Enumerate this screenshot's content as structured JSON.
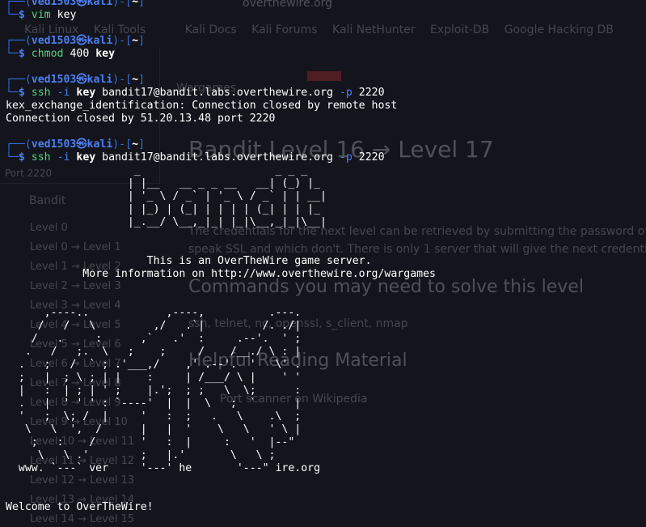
{
  "background": {
    "url_domain": "overthewire.org",
    "bookmarks": [
      "Kali Linux",
      "Kali Tools",
      "Kali Docs",
      "Kali Forums",
      "Kali NetHunter",
      "Exploit-DB",
      "Google Hacking DB"
    ],
    "wargames_label": "Wargames",
    "port_label": "Port 2220",
    "sidebar_title": "Bandit",
    "page_title": "Bandit Level 16 → Level 17",
    "text_1": "The credentials for the next level can be retrieved by submitting the password of the c",
    "text_2": "speak SSL and which don't. There is only 1 server that will give the next credentials, th",
    "commands_heading": "Commands you may need to solve this level",
    "commands_list": "ssh, telnet, nc, openssl, s_client, nmap",
    "reading_heading": "Helpful Reading Material",
    "reading_link": "Port scanner on Wikipedia",
    "levels": [
      "Level 0",
      "Level 0 → Level 1",
      "Level 1 → Level 2",
      "Level 2 → Level 3",
      "Level 3 → Level 4",
      "Level 4 → Level 5",
      "Level 5 → Level 6",
      "Level 6 → Level 7",
      "Level 7 → Level 8",
      "Level 8 → Level 9",
      "Level 9 → Level 10",
      "Level 10 → Level 11",
      "Level 11 → Level 12",
      "Level 12 → Level 13",
      "Level 13 → Level 14",
      "Level 14 → Level 15"
    ]
  },
  "prompt": {
    "user": "ved1503",
    "at_symbol": "㉿",
    "host": "kali",
    "dir": "~",
    "top_left": "┌──(",
    "close_paren": ")-[",
    "close_bracket": "]",
    "bottom_left": "└─",
    "dollar": "$"
  },
  "commands": [
    {
      "cmd": "vim",
      "args": " key",
      "bold_key": ""
    },
    {
      "cmd": "chmod",
      "args": " 400 ",
      "bold_key": "key"
    },
    {
      "cmd": "ssh",
      "opt1": " -i ",
      "bold_key": "key",
      "host": " bandit17@bandit.labs.overthewire.org ",
      "opt2": "-p",
      "port": " 2220"
    },
    {
      "cmd": "ssh",
      "opt1": " -i ",
      "bold_key": "key",
      "host": " bandit17@bandit.labs.overthewire.org ",
      "opt2": "-p",
      "port": " 2220"
    }
  ],
  "output": {
    "kex_error": "kex_exchange_identification: Connection closed by remote host",
    "closed": "Connection closed by 51.20.13.48 port 2220"
  },
  "banner_art": [
    "                    _                     _ _ _",
    "                   | |__   __ _ _ __   __| (_) |_",
    "                   | '_ \\ / _` | '_ \\ / _` | | __|",
    "                   | |_) | (_| | | | | (_| | | |_",
    "                   |_.__/ \\__,_|_| |_|\\__,_|_|\\__|"
  ],
  "server_msg_1": "                      This is an OverTheWire game server.",
  "server_msg_2": "            More information on http://www.overthewire.org/wargames",
  "otw_art": [
    "      ,----..            ,----,          .---.",
    "     /   /   \\         ,/   .`|         /. ./|",
    "    /   .     :      ,`   .'  :     .--'.  ' ;",
    "   .   /   ;.  \\   ;    ;     /    /__./ \\ : |",
    "  .   ;   /  ` ; .'___,/    ,' .--'.  '   \\' .",
    "  ;   |  ; \\ ; | |    :     | /___/ \\ |    ' '",
    "  |   :  | ; | ' ;    |.';  ; ;   \\  \\;      :",
    "  .   |  ' ' ' : `----'  |  |  \\   ;  `      |",
    "  '   ;  \\; /  |     '   :  ;   .   \\    .\\  ;",
    "   \\   \\  ',  /      |   |  '    \\   \\   ' \\ |",
    "    ;   :    /       '   :  |     :   '  |--\"",
    "     \\   \\ .'        ;   |.'       \\   \\ ;",
    "  www. `---` ver     '---' he       '---\" ire.org"
  ],
  "welcome": "Welcome to OverTheWire!"
}
